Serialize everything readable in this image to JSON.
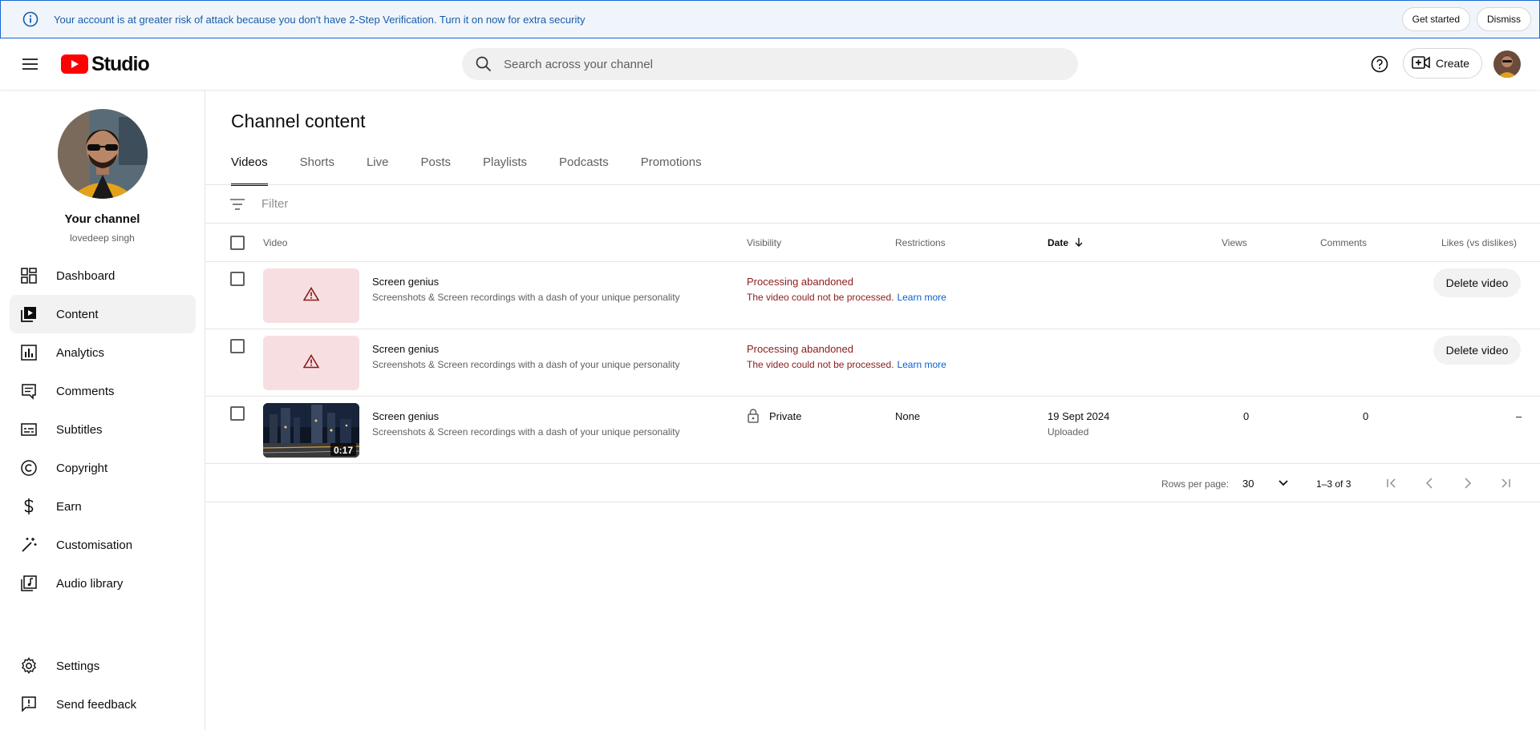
{
  "banner": {
    "message": "Your account is at greater risk of attack because you don't have 2-Step Verification. Turn it on now for extra security",
    "get_started": "Get started",
    "dismiss": "Dismiss"
  },
  "header": {
    "logo_text": "Studio",
    "search_placeholder": "Search across your channel",
    "create_label": "Create"
  },
  "sidebar": {
    "channel_title": "Your channel",
    "channel_name": "lovedeep singh",
    "items": [
      {
        "label": "Dashboard",
        "icon": "dashboard-icon"
      },
      {
        "label": "Content",
        "icon": "content-icon",
        "active": true
      },
      {
        "label": "Analytics",
        "icon": "analytics-icon"
      },
      {
        "label": "Comments",
        "icon": "comments-icon"
      },
      {
        "label": "Subtitles",
        "icon": "subtitles-icon"
      },
      {
        "label": "Copyright",
        "icon": "copyright-icon"
      },
      {
        "label": "Earn",
        "icon": "earn-icon"
      },
      {
        "label": "Customisation",
        "icon": "customisation-icon"
      },
      {
        "label": "Audio library",
        "icon": "audio-library-icon"
      }
    ],
    "bottom_items": [
      {
        "label": "Settings",
        "icon": "settings-icon"
      },
      {
        "label": "Send feedback",
        "icon": "feedback-icon"
      }
    ]
  },
  "main": {
    "title": "Channel content",
    "tabs": [
      "Videos",
      "Shorts",
      "Live",
      "Posts",
      "Playlists",
      "Podcasts",
      "Promotions"
    ],
    "active_tab": "Videos",
    "filter_placeholder": "Filter",
    "columns": {
      "video": "Video",
      "visibility": "Visibility",
      "restrictions": "Restrictions",
      "date": "Date",
      "views": "Views",
      "comments": "Comments",
      "likes": "Likes (vs dislikes)"
    },
    "rows": [
      {
        "title": "Screen genius",
        "description": "Screenshots & Screen recordings with a dash of your unique personality",
        "status": "Processing abandoned",
        "status_detail": "The video could not be processed.",
        "learn_more": "Learn more",
        "delete_label": "Delete video"
      },
      {
        "title": "Screen genius",
        "description": "Screenshots & Screen recordings with a dash of your unique personality",
        "status": "Processing abandoned",
        "status_detail": "The video could not be processed.",
        "learn_more": "Learn more",
        "delete_label": "Delete video"
      },
      {
        "title": "Screen genius",
        "description": "Screenshots & Screen recordings with a dash of your unique personality",
        "duration": "0:17",
        "visibility": "Private",
        "restrictions": "None",
        "date": "19 Sept 2024",
        "date_status": "Uploaded",
        "views": "0",
        "comments": "0",
        "likes": "–"
      }
    ],
    "pagination": {
      "rows_per_page_label": "Rows per page:",
      "rows_per_page": "30",
      "range": "1–3 of 3"
    }
  },
  "colors": {
    "banner_border": "#1967d2",
    "banner_bg": "#f0f5fb",
    "logo_red": "#ff0000",
    "error_text": "#8a1c1c",
    "link_blue": "#065fd4",
    "error_thumb": "#f7dfe1"
  }
}
